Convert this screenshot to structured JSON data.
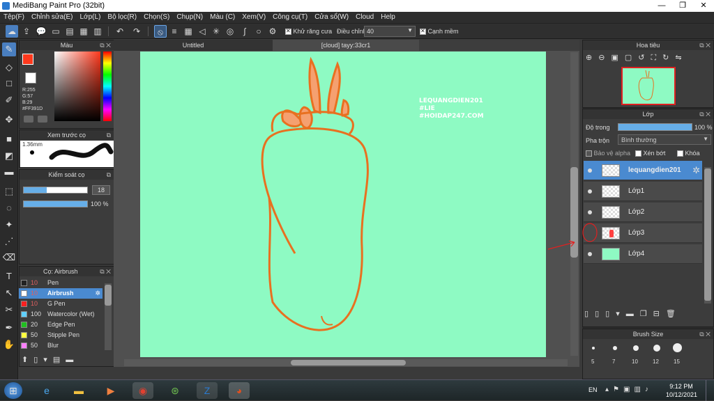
{
  "window": {
    "title": "MediBang Paint Pro (32bit)"
  },
  "menu": [
    "Tệp(F)",
    "Chỉnh sửa(E)",
    "Lớp(L)",
    "Bộ lọc(R)",
    "Chọn(S)",
    "Chụp(N)",
    "Màu (C)",
    "Xem(V)",
    "Công cụ(T)",
    "Cửa sổ(W)",
    "Cloud",
    "Help"
  ],
  "toolbar": {
    "antialias_label": "Khử răng cưa",
    "adjust_label": "Điều chỉnh",
    "adjust_value": "40",
    "sharp_label": "Cạnh mềm"
  },
  "color_panel": {
    "title": "Màu",
    "r": "R:255",
    "g": "G:57",
    "b": "B:29",
    "hex": "#FF391D",
    "primary": "#ff391d"
  },
  "brush_preview": {
    "title": "Xem trước cọ",
    "size": "1.36mm"
  },
  "brush_control": {
    "title": "Kiểm soát cọ",
    "size": "18",
    "opacity": "100 %"
  },
  "brush_list": {
    "title": "Cọ: Airbrush",
    "items": [
      {
        "size": "10",
        "name": "Pen",
        "color": "#222222"
      },
      {
        "size": "10",
        "name": "Airbrush",
        "color": "#ffffff",
        "selected": true
      },
      {
        "size": "10",
        "name": "G Pen",
        "color": "#ff2020"
      },
      {
        "size": "100",
        "name": "Watercolor (Wet)",
        "color": "#60d0ff"
      },
      {
        "size": "20",
        "name": "Edge Pen",
        "color": "#20c020"
      },
      {
        "size": "50",
        "name": "Stipple Pen",
        "color": "#ffff40"
      },
      {
        "size": "50",
        "name": "Blur",
        "color": "#ff80ff"
      }
    ]
  },
  "tabs": {
    "doc1": "Untitled",
    "doc2": "[cloud] tayy:33cr1"
  },
  "canvas": {
    "bg_color": "#8efac3",
    "line_color": "#e87020",
    "watermark": [
      "LEQUANGDIEN201",
      "#LIE",
      "#HOIDAP247.COM"
    ]
  },
  "navigator": {
    "title": "Hoa tiêu"
  },
  "layer_panel": {
    "title": "Lớp",
    "opacity_label": "Độ trong",
    "opacity_value": "100 %",
    "blend_label": "Pha trộn",
    "blend_value": "Bình thường",
    "protect_alpha": "Bảo vệ alpha",
    "clip": "Xén bớt",
    "lock": "Khóa",
    "layers": [
      {
        "name": "lequangdien201",
        "selected": true
      },
      {
        "name": "Lớp1"
      },
      {
        "name": "Lớp2"
      },
      {
        "name": "Lớp3"
      },
      {
        "name": "Lớp4"
      }
    ]
  },
  "brush_size": {
    "title": "Brush Size",
    "sizes": [
      "5",
      "7",
      "10",
      "12",
      "15"
    ]
  },
  "taskbar": {
    "lang": "EN",
    "time": "9:12 PM",
    "date": "10/12/2021"
  }
}
